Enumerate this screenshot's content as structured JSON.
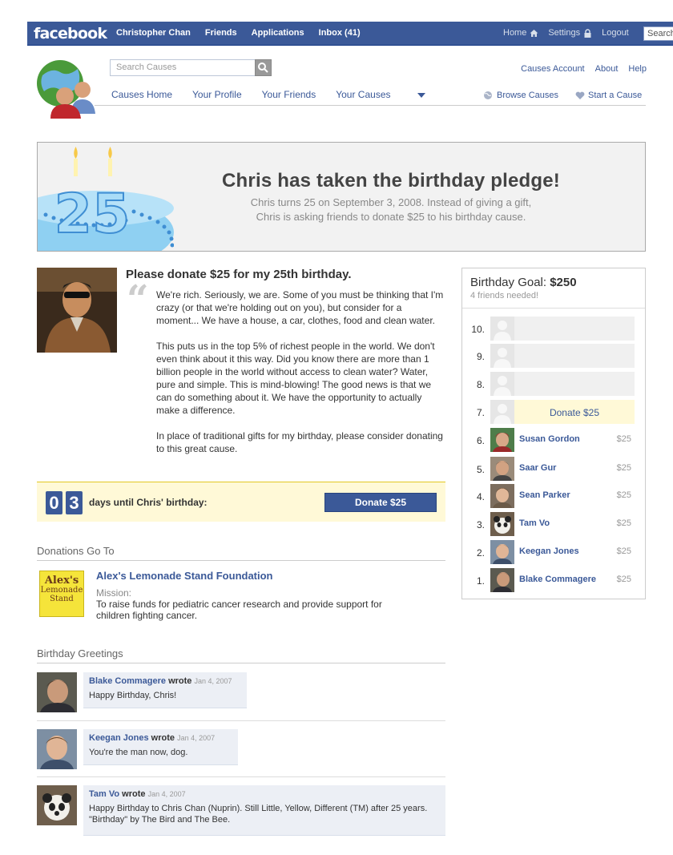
{
  "topbar": {
    "logo": "facebook",
    "nav": [
      "Christopher Chan",
      "Friends",
      "Applications",
      "Inbox (41)"
    ],
    "home": "Home",
    "settings": "Settings",
    "logout": "Logout",
    "search_placeholder": "Search"
  },
  "causes_header": {
    "search_placeholder": "Search Causes",
    "subnav": [
      "Causes Home",
      "Your Profile",
      "Your Friends",
      "Your Causes"
    ],
    "toplinks": [
      "Causes Account",
      "About",
      "Help"
    ],
    "browse": "Browse Causes",
    "start": "Start a Cause"
  },
  "banner": {
    "number": "25",
    "title": "Chris has taken the birthday pledge!",
    "line1": "Chris turns 25 on September 3, 2008. Instead of giving a gift,",
    "line2": "Chris is asking friends to donate $25 to his birthday cause."
  },
  "appeal": {
    "title": "Please donate $25 for my 25th birthday.",
    "quote": "“",
    "paragraphs": [
      "We're rich. Seriously, we are. Some of you must be thinking that I'm crazy (or that we're holding out on you), but consider for a moment... We have a house, a car, clothes, food and clean water.",
      "This puts us in the top 5% of richest people in the world. We don't even think about it this way. Did you know there are more than 1 billion people in the world without access to clean water? Water, pure and simple. This is mind-blowing! The good news is that we can do something about it. We have the opportunity to actually make a difference.",
      "In place of traditional gifts for my birthday, please consider donating to this great cause."
    ]
  },
  "countdown": {
    "digit1": "0",
    "digit2": "3",
    "label": "days until Chris' birthday:",
    "button": "Donate $25"
  },
  "donations": {
    "heading": "Donations Go To",
    "logo_text": [
      "Alex's",
      "Lemonade",
      "Stand"
    ],
    "name": "Alex's Lemonade Stand Foundation",
    "mission_label": "Mission:",
    "mission": "To raise funds for pediatric cancer research and provide support for children fighting cancer."
  },
  "greetings": {
    "heading": "Birthday Greetings",
    "items": [
      {
        "name": "Blake Commagere",
        "wrote": "wrote",
        "date": "Jan 4, 2007",
        "message": "Happy Birthday, Chris!"
      },
      {
        "name": "Keegan Jones",
        "wrote": "wrote",
        "date": "Jan 4, 2007",
        "message": "You're the man now, dog."
      },
      {
        "name": "Tam Vo",
        "wrote": "wrote",
        "date": "Jan 4, 2007",
        "message": "Happy Birthday to Chris Chan (Nuprin). Still Little, Yellow, Different (TM) after 25 years. \"Birthday\" by The Bird and The Bee."
      }
    ]
  },
  "goal": {
    "label": "Birthday Goal:",
    "amount": "$250",
    "sub": "4 friends needed!",
    "donate_slot": "Donate $25",
    "slots": [
      {
        "n": "10.",
        "name": "",
        "amount": ""
      },
      {
        "n": "9.",
        "name": "",
        "amount": ""
      },
      {
        "n": "8.",
        "name": "",
        "amount": ""
      },
      {
        "n": "7.",
        "name": "",
        "amount": ""
      },
      {
        "n": "6.",
        "name": "Susan Gordon",
        "amount": "$25"
      },
      {
        "n": "5.",
        "name": "Saar Gur",
        "amount": "$25"
      },
      {
        "n": "4.",
        "name": "Sean Parker",
        "amount": "$25"
      },
      {
        "n": "3.",
        "name": "Tam Vo",
        "amount": "$25"
      },
      {
        "n": "2.",
        "name": "Keegan Jones",
        "amount": "$25"
      },
      {
        "n": "1.",
        "name": "Blake Commagere",
        "amount": "$25"
      }
    ]
  },
  "colors": {
    "facebook_blue": "#3b5998",
    "highlight_yellow": "#fff9d7",
    "cake_blue": "#8fd0f2"
  }
}
